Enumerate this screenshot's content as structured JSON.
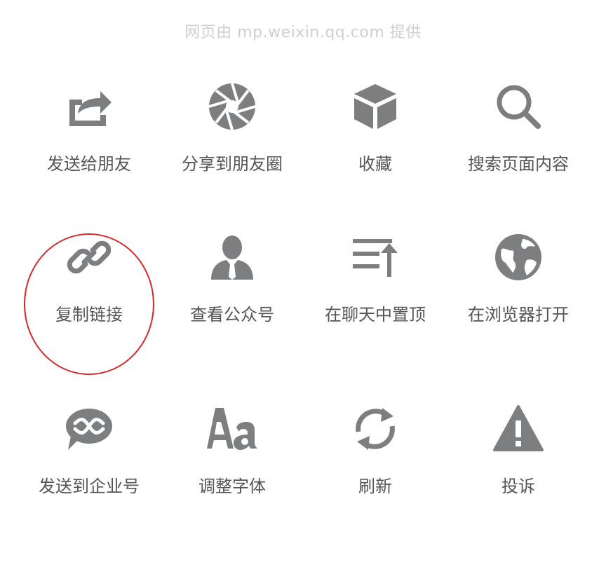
{
  "provider_text": "网页由 mp.weixin.qq.com 提供",
  "icon_color": "#7d7e80",
  "highlight_color": "#d42a2a",
  "actions": [
    {
      "label": "发送给朋友",
      "icon": "share-arrow-icon"
    },
    {
      "label": "分享到朋友圈",
      "icon": "moments-aperture-icon"
    },
    {
      "label": "收藏",
      "icon": "favorite-cube-icon"
    },
    {
      "label": "搜索页面内容",
      "icon": "search-icon"
    },
    {
      "label": "复制链接",
      "icon": "link-icon"
    },
    {
      "label": "查看公众号",
      "icon": "official-account-person-icon"
    },
    {
      "label": "在聊天中置顶",
      "icon": "pin-to-top-icon"
    },
    {
      "label": "在浏览器打开",
      "icon": "globe-icon"
    },
    {
      "label": "发送到企业号",
      "icon": "enterprise-chat-bubble-icon"
    },
    {
      "label": "调整字体",
      "icon": "font-size-icon"
    },
    {
      "label": "刷新",
      "icon": "refresh-icon"
    },
    {
      "label": "投诉",
      "icon": "warning-icon"
    }
  ]
}
